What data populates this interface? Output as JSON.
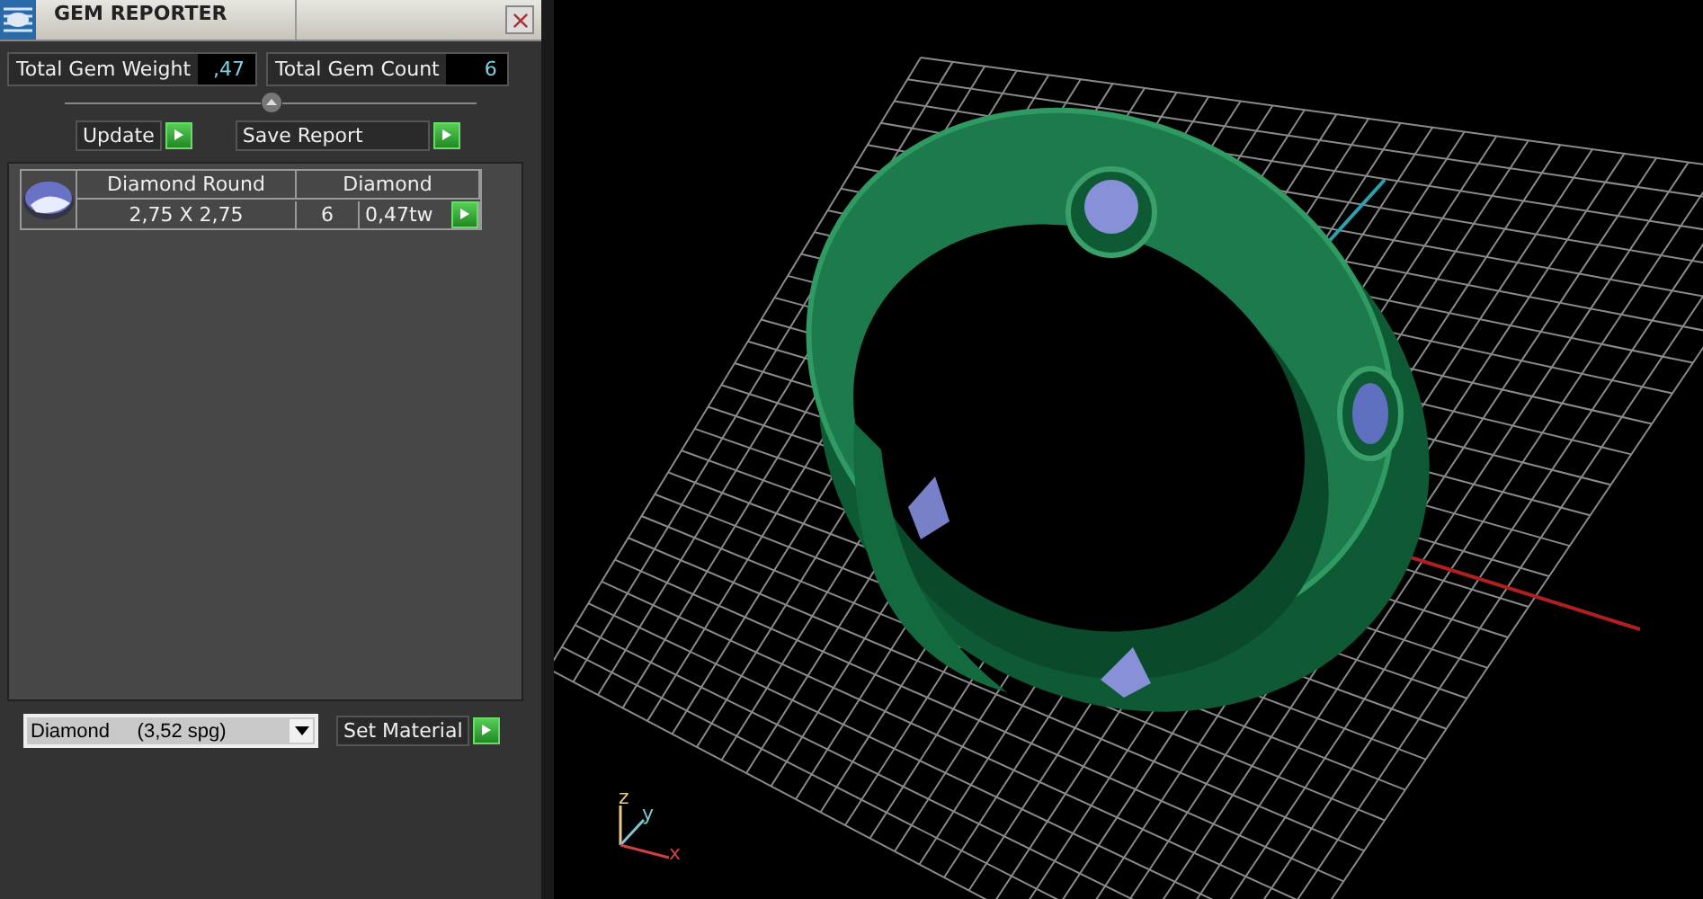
{
  "window": {
    "title": "GEM REPORTER"
  },
  "stats": [
    {
      "label": "Total Gem Weight",
      "value": ",47"
    },
    {
      "label": "Total Gem Count",
      "value": "6"
    }
  ],
  "buttons": [
    {
      "label": "Update",
      "kind": "short"
    },
    {
      "label": "Save Report",
      "kind": "wide"
    }
  ],
  "gems": [
    {
      "name": "Diamond Round",
      "material": "Diamond",
      "size": "2,75 X 2,75",
      "count": "6",
      "weight": "0,47tw"
    }
  ],
  "material_select": {
    "value": "Diamond     (3,52 spg)"
  },
  "set_material_button": {
    "label": "Set Material"
  },
  "viewport": {
    "axes": [
      {
        "label": "z",
        "color": "#e8c890"
      },
      {
        "label": "y",
        "color": "#7fc8d0"
      },
      {
        "label": "x",
        "color": "#d04040"
      }
    ]
  }
}
